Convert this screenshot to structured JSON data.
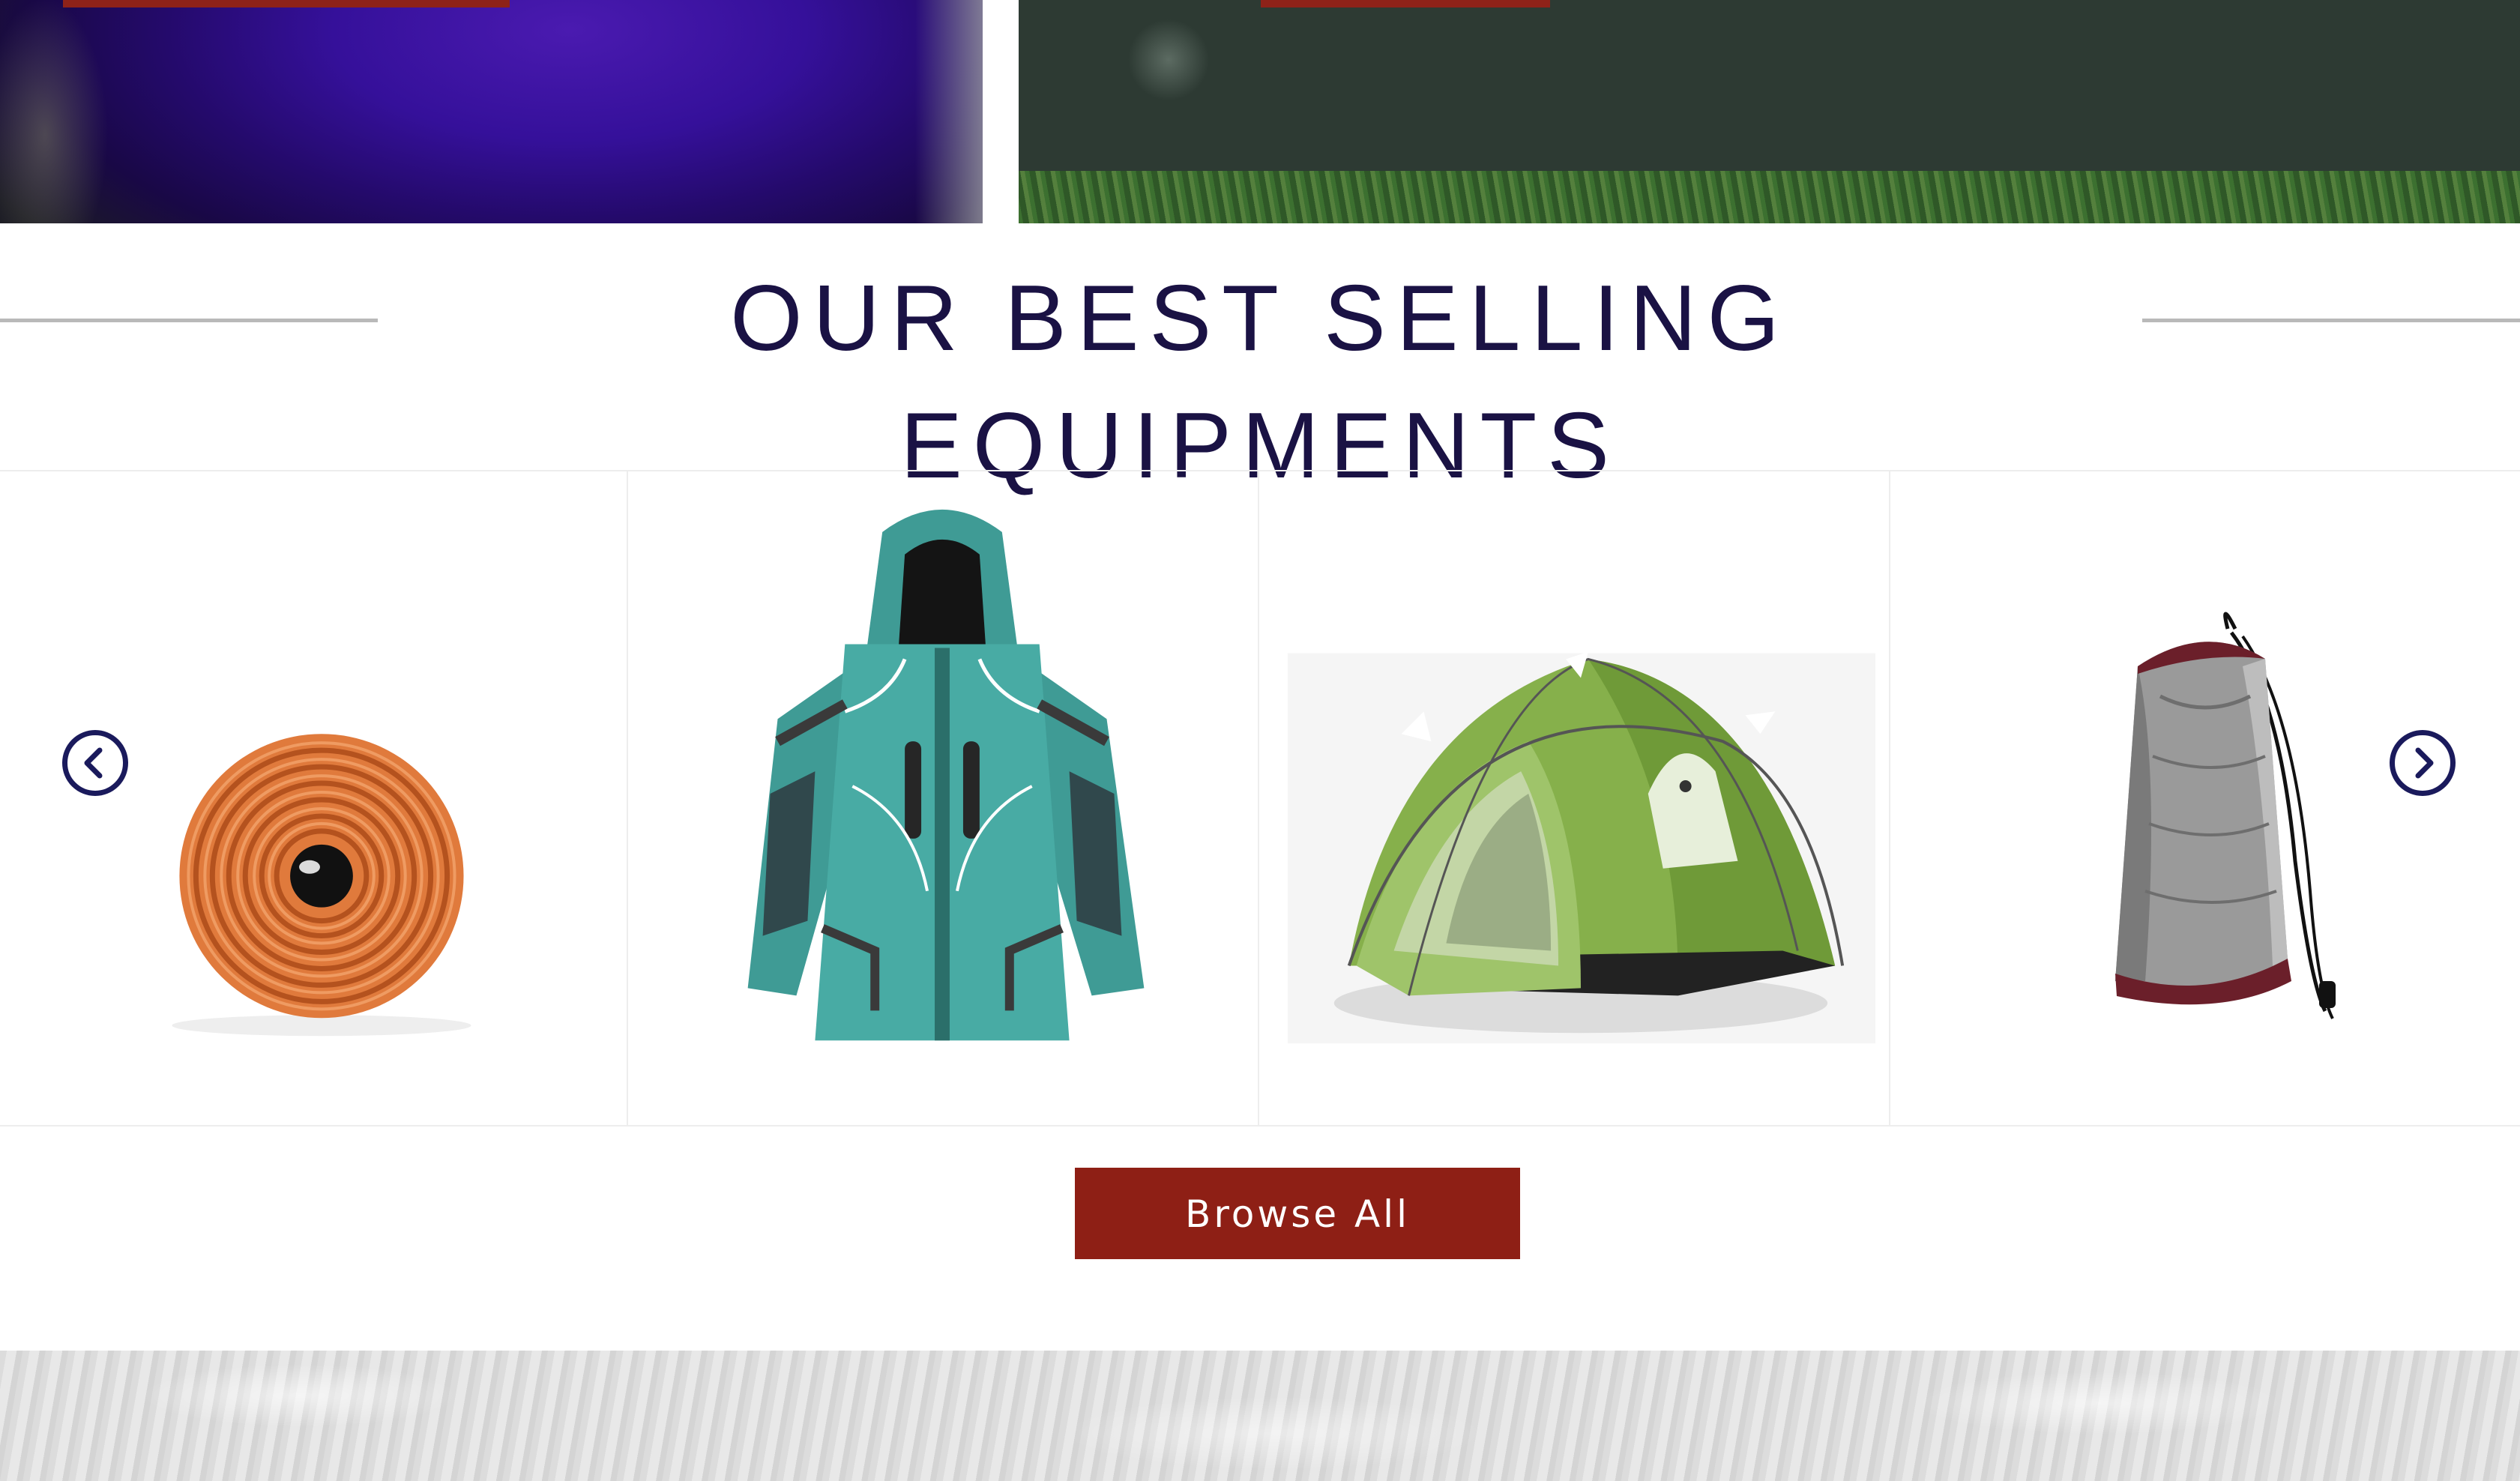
{
  "hero": {
    "panels": [
      "jacket-photo",
      "rocky-field-photo"
    ],
    "accent_color": "#8e2219"
  },
  "section": {
    "title": "OUR BEST SELLING EQUIPMENTS"
  },
  "carousel": {
    "products": [
      {
        "name": "sleeping-mat",
        "icon": "rolled-mat-image"
      },
      {
        "name": "rain-jacket",
        "icon": "jacket-image"
      },
      {
        "name": "dome-tent",
        "icon": "tent-image"
      },
      {
        "name": "sleeping-bag",
        "icon": "stuff-sack-image"
      }
    ],
    "prev_icon": "chevron-left-icon",
    "next_icon": "chevron-right-icon",
    "arrow_color": "#1a1a5c"
  },
  "actions": {
    "browse_label": "Browse All",
    "browse_color": "#8e1f15"
  },
  "colors": {
    "title": "#1a1244",
    "divider": "#b9b9b9"
  }
}
